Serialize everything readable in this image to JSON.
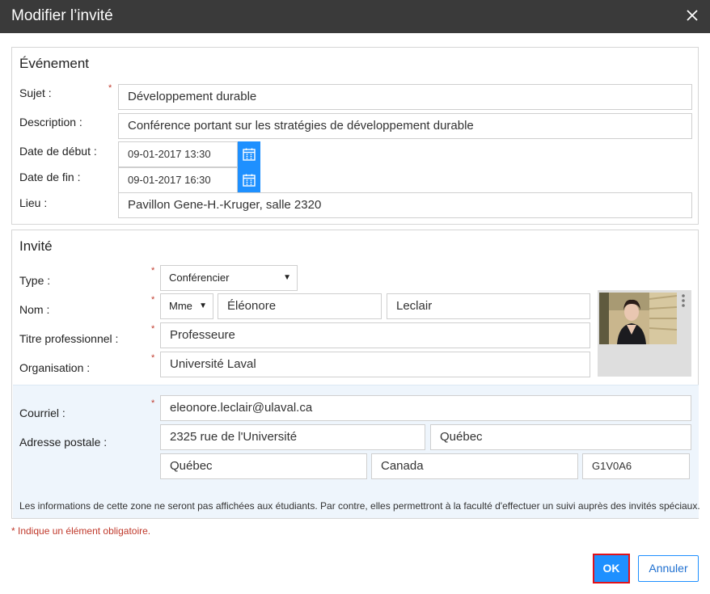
{
  "dialog": {
    "title": "Modifier l’invité"
  },
  "event": {
    "title": "Événement",
    "subject_label": "Sujet :",
    "subject_value": "Développement durable",
    "description_label": "Description :",
    "description_value": "Conférence portant sur les stratégies de développement durable",
    "start_label": "Date de début :",
    "start_value": "09-01-2017 13:30",
    "end_label": "Date de fin :",
    "end_value": "09-01-2017 16:30",
    "location_label": "Lieu :",
    "location_value": "Pavillon Gene-H.-Kruger, salle 2320"
  },
  "guest": {
    "title": "Invité",
    "type_label": "Type :",
    "type_value": "Conférencier",
    "name_label": "Nom :",
    "salutation_value": "Mme",
    "first_name_value": "Éléonore",
    "last_name_value": "Leclair",
    "job_title_label": "Titre professionnel :",
    "job_title_value": "Professeure",
    "organization_label": "Organisation :",
    "organization_value": "Université Laval",
    "email_label": "Courriel :",
    "email_value": "eleonore.leclair@ulaval.ca",
    "address_label": "Adresse postale :",
    "street_value": "2325 rue de l'Université",
    "city_value": "Québec",
    "province_value": "Québec",
    "country_value": "Canada",
    "postal_value": "G1V0A6",
    "privacy_note": "Les informations de cette zone ne seront pas affichées aux étudiants. Par contre, elles permettront à la faculté d'effectuer un suivi auprès des invités spéciaux."
  },
  "required_marker": "*",
  "required_note": "* Indique un élément obligatoire.",
  "actions": {
    "ok_label": "OK",
    "cancel_label": "Annuler"
  },
  "colors": {
    "accent": "#1e90ff",
    "required": "#c0392b",
    "titlebar": "#3a3a3a",
    "highlight": "#e0121b"
  }
}
